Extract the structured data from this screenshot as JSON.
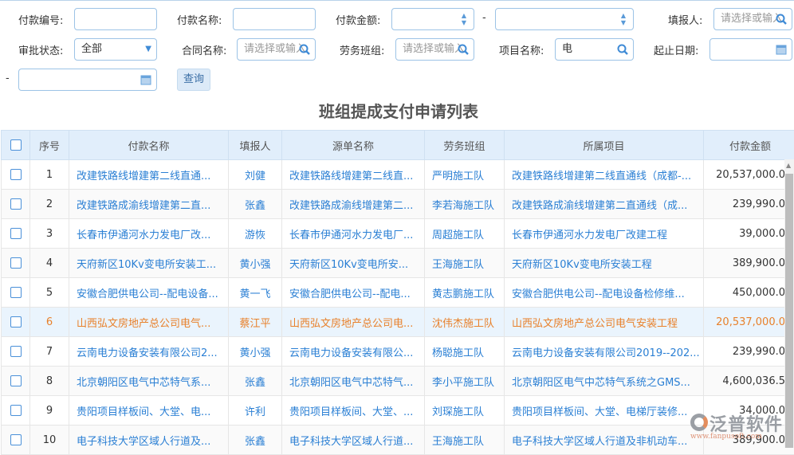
{
  "filters": {
    "payment_no": {
      "label": "付款编号:",
      "value": ""
    },
    "payment_name": {
      "label": "付款名称:",
      "value": ""
    },
    "payment_amount": {
      "label": "付款金额:",
      "from": "",
      "to": "",
      "sep": "-"
    },
    "reporter": {
      "label": "填报人:",
      "placeholder": "请选择或输入"
    },
    "approval_status": {
      "label": "审批状态:",
      "value": "全部"
    },
    "contract_name": {
      "label": "合同名称:",
      "placeholder": "请选择或输入"
    },
    "labor_team": {
      "label": "劳务班组:",
      "placeholder": "请选择或输入"
    },
    "project_name": {
      "label": "项目名称:",
      "value": "电"
    },
    "date_range": {
      "label": "起止日期:",
      "from": "",
      "to": "",
      "sep": "-"
    },
    "query_button": "查询"
  },
  "title": "班组提成支付申请列表",
  "table": {
    "columns": [
      "序号",
      "付款名称",
      "填报人",
      "源单名称",
      "劳务班组",
      "所属项目",
      "付款金额"
    ],
    "rows": [
      {
        "seq": "1",
        "name": "改建铁路线增建第二线直通...",
        "reporter": "刘健",
        "source": "改建铁路线增建第二线直...",
        "team": "严明施工队",
        "project": "改建铁路线增建第二线直通线（成都-...",
        "amount": "20,537,000.0"
      },
      {
        "seq": "2",
        "name": "改建铁路成渝线增建第二直...",
        "reporter": "张鑫",
        "source": "改建铁路成渝线增建第二...",
        "team": "李若海施工队",
        "project": "改建铁路成渝线增建第二直通线（成...",
        "amount": "239,990.0"
      },
      {
        "seq": "3",
        "name": "长春市伊通河水力发电厂改...",
        "reporter": "游恢",
        "source": "长春市伊通河水力发电厂...",
        "team": "周超施工队",
        "project": "长春市伊通河水力发电厂改建工程",
        "amount": "39,000.0"
      },
      {
        "seq": "4",
        "name": "天府新区10Kv变电所安装工...",
        "reporter": "黄小强",
        "source": "天府新区10Kv变电所安...",
        "team": "王海施工队",
        "project": "天府新区10Kv变电所安装工程",
        "amount": "389,900.0"
      },
      {
        "seq": "5",
        "name": "安徽合肥供电公司--配电设备...",
        "reporter": "黄一飞",
        "source": "安徽合肥供电公司--配电...",
        "team": "黄志鹏施工队",
        "project": "安徽合肥供电公司--配电设备检修维...",
        "amount": "450,000.0"
      },
      {
        "seq": "6",
        "name": "山西弘文房地产总公司电气...",
        "reporter": "蔡江平",
        "source": "山西弘文房地产总公司电...",
        "team": "沈伟杰施工队",
        "project": "山西弘文房地产总公司电气安装工程",
        "amount": "20,537,000.0"
      },
      {
        "seq": "7",
        "name": "云南电力设备安装有限公司2...",
        "reporter": "黄小强",
        "source": "云南电力设备安装有限公...",
        "team": "杨聪施工队",
        "project": "云南电力设备安装有限公司2019--202...",
        "amount": "239,990.0"
      },
      {
        "seq": "8",
        "name": "北京朝阳区电气中芯特气系...",
        "reporter": "张鑫",
        "source": "北京朝阳区电气中芯特气...",
        "team": "李小平施工队",
        "project": "北京朝阳区电气中芯特气系统之GMS...",
        "amount": "4,600,036.5"
      },
      {
        "seq": "9",
        "name": "贵阳项目样板间、大堂、电...",
        "reporter": "许利",
        "source": "贵阳项目样板间、大堂、...",
        "team": "刘琛施工队",
        "project": "贵阳项目样板间、大堂、电梯厅装修...",
        "amount": "34,000.0"
      },
      {
        "seq": "10",
        "name": "电子科技大学区域人行道及...",
        "reporter": "张鑫",
        "source": "电子科技大学区域人行道...",
        "team": "王海施工队",
        "project": "电子科技大学区域人行道及非机动车...",
        "amount": "389,900.0"
      }
    ],
    "highlighted_row": 6
  },
  "watermark": {
    "brand": "泛普软件",
    "url": "www.fanpusoft.com"
  },
  "colors": {
    "link": "#2a7fd4",
    "highlight": "#e8812b",
    "header_bg": "#e1eefb"
  }
}
